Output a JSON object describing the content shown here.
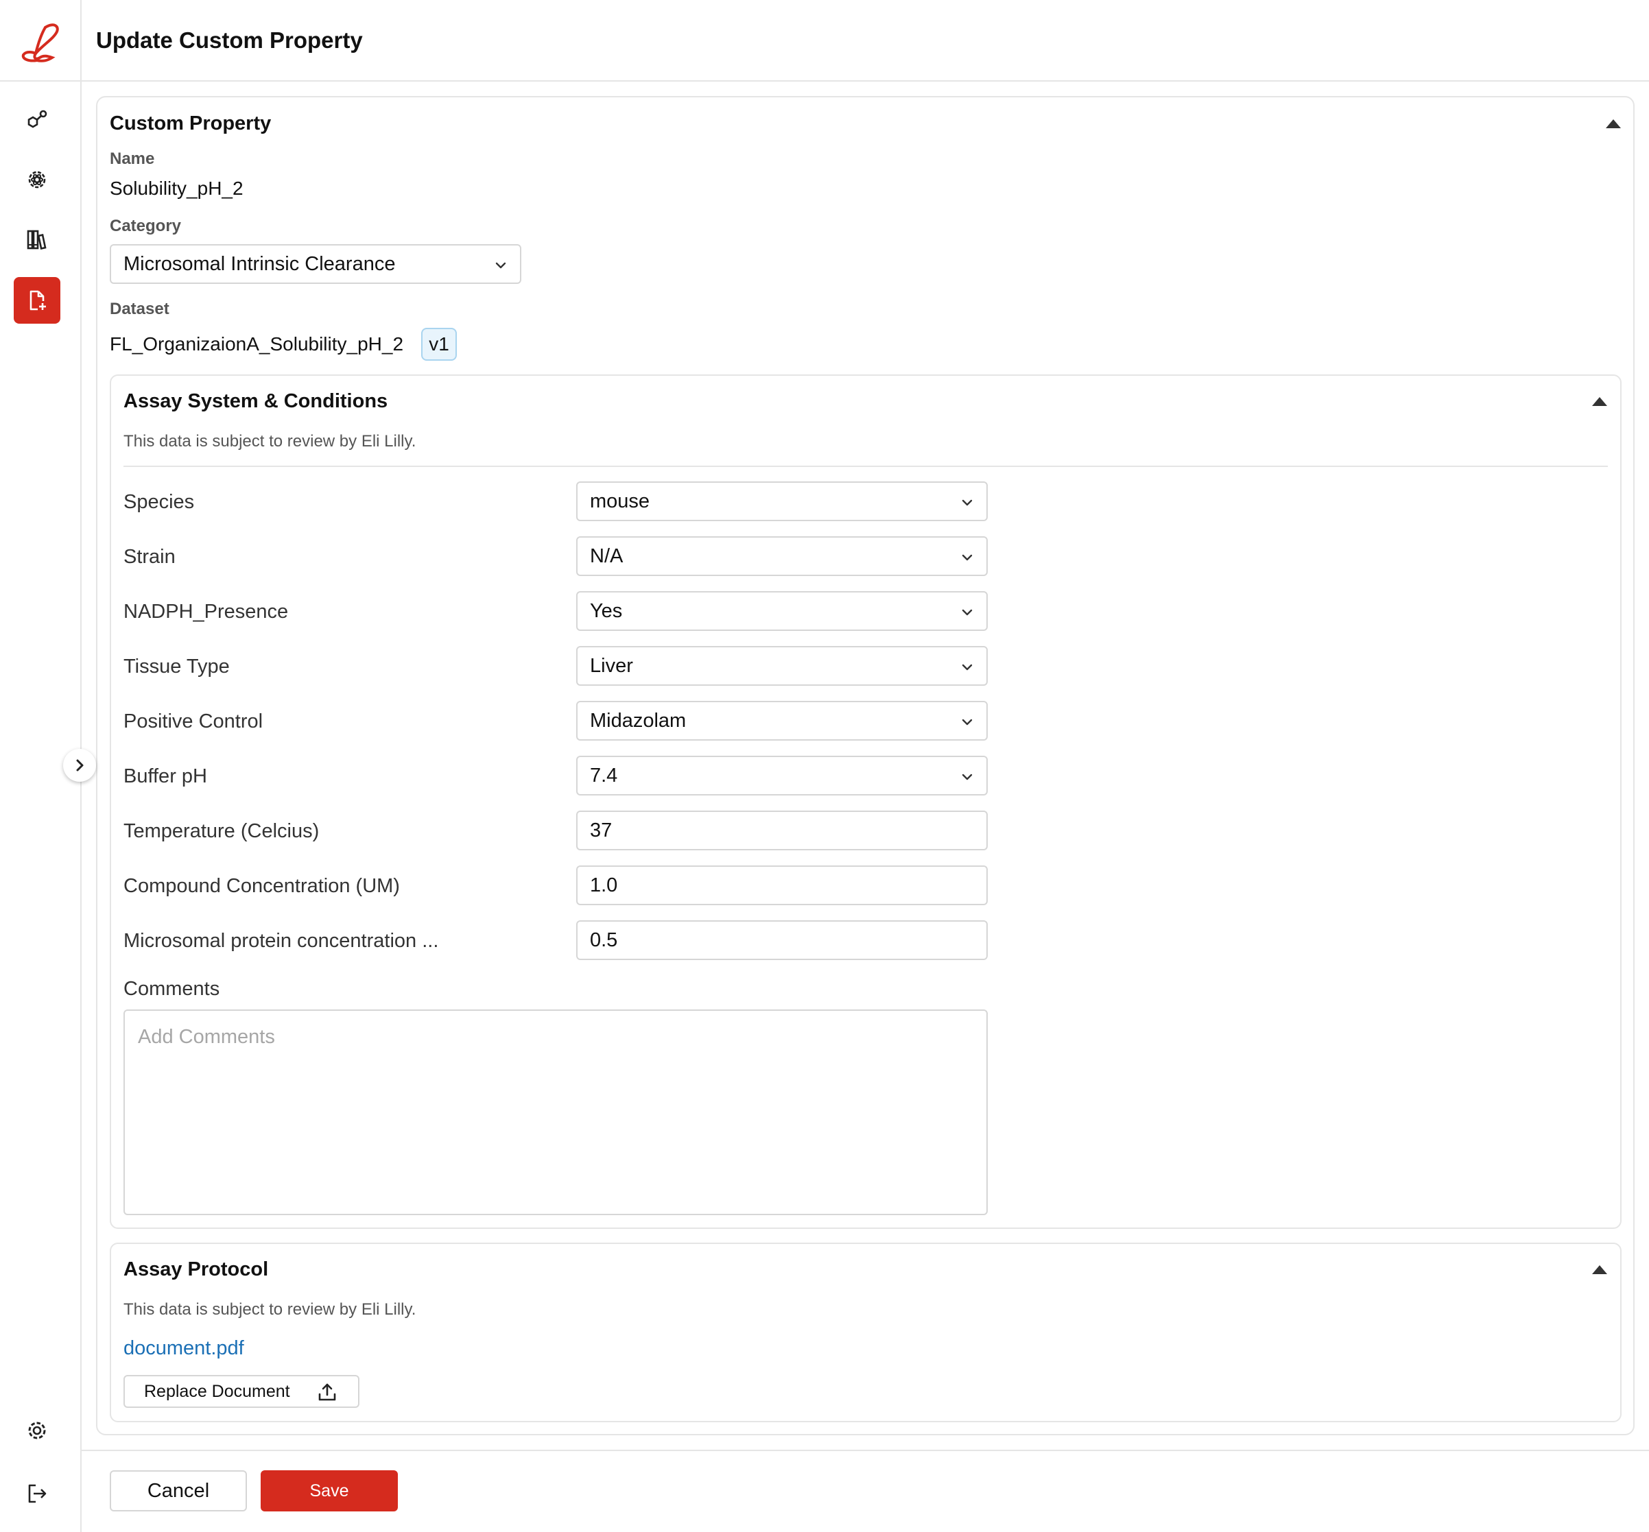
{
  "header": {
    "title": "Update Custom Property"
  },
  "sidebar": {
    "logo": "lilly-logo",
    "items": [
      {
        "icon": "molecule-icon",
        "active": false
      },
      {
        "icon": "atom-gear-icon",
        "active": false
      },
      {
        "icon": "library-icon",
        "active": false
      },
      {
        "icon": "file-add-icon",
        "active": true
      }
    ],
    "bottom_items": [
      {
        "icon": "gear-icon"
      },
      {
        "icon": "logout-icon"
      }
    ]
  },
  "custom_property": {
    "title": "Custom Property",
    "name_label": "Name",
    "name_value": "Solubility_pH_2",
    "category_label": "Category",
    "category_value": "Microsomal Intrinsic Clearance",
    "dataset_label": "Dataset",
    "dataset_value": "FL_OrganizaionA_Solubility_pH_2",
    "dataset_version": "v1"
  },
  "assay_system": {
    "title": "Assay System & Conditions",
    "note": "This data is subject to review by Eli Lilly.",
    "fields": [
      {
        "label": "Species",
        "value": "mouse",
        "type": "select"
      },
      {
        "label": "Strain",
        "value": "N/A",
        "type": "select"
      },
      {
        "label": "NADPH_Presence",
        "value": "Yes",
        "type": "select"
      },
      {
        "label": "Tissue Type",
        "value": "Liver",
        "type": "select"
      },
      {
        "label": "Positive Control",
        "value": "Midazolam",
        "type": "select"
      },
      {
        "label": "Buffer pH",
        "value": "7.4",
        "type": "select"
      },
      {
        "label": "Temperature (Celcius)",
        "value": "37",
        "type": "input"
      },
      {
        "label": "Compound Concentration (UM)",
        "value": "1.0",
        "type": "input"
      },
      {
        "label": "Microsomal protein concentration ...",
        "value": "0.5",
        "type": "input"
      }
    ],
    "comments_label": "Comments",
    "comments_placeholder": "Add Comments"
  },
  "assay_protocol": {
    "title": "Assay Protocol",
    "note": "This data is subject to review by Eli Lilly.",
    "document_name": "document.pdf",
    "replace_label": "Replace Document"
  },
  "footer": {
    "cancel_label": "Cancel",
    "save_label": "Save"
  },
  "colors": {
    "brand_red": "#d52b1e",
    "link_blue": "#1a6fb5",
    "badge_bg": "#e8f4fc",
    "border": "#e5e5e5"
  }
}
